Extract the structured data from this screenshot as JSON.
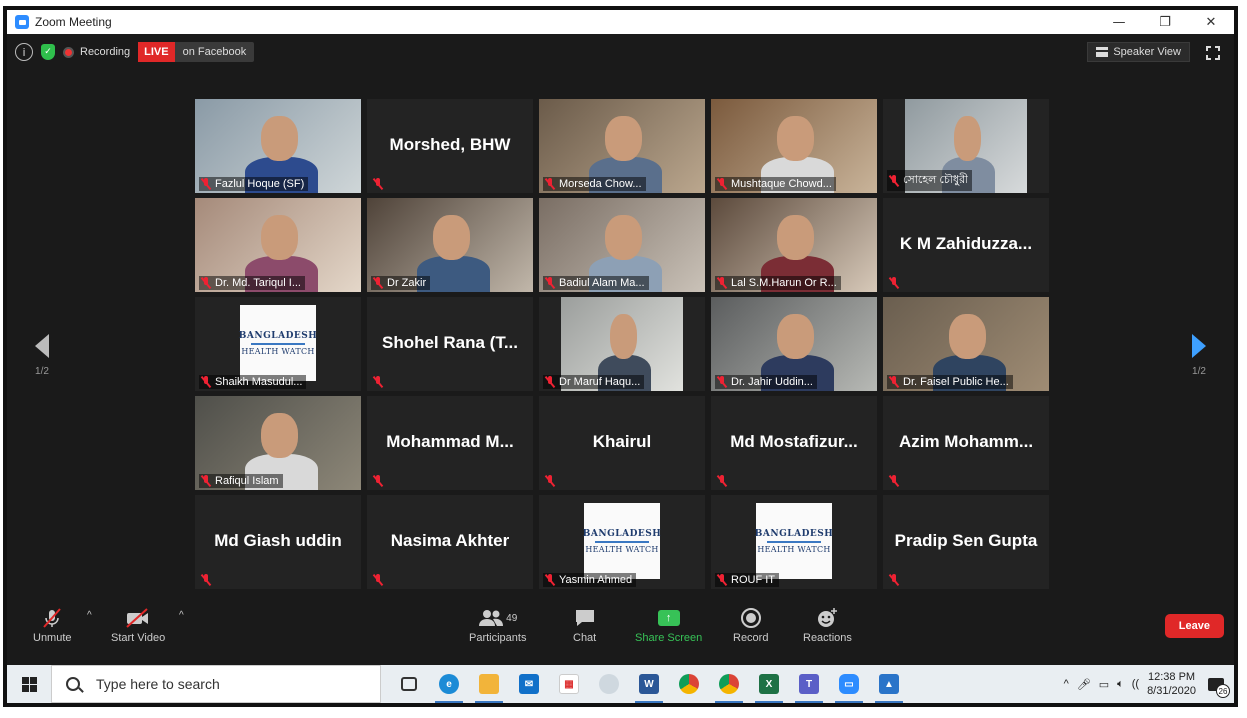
{
  "window": {
    "title": "Zoom Meeting",
    "controls": [
      "—",
      "❐",
      "✕"
    ]
  },
  "meeting_top": {
    "recording_label": "Recording",
    "live_badge": "LIVE",
    "live_target": "on Facebook",
    "view_button": "Speaker View"
  },
  "pager": {
    "left_page": "1/2",
    "right_page": "1/2"
  },
  "participants": [
    {
      "label": "Fazlul Hoque (SF)",
      "video": true
    },
    {
      "label": "Morshed, BHW",
      "video": false
    },
    {
      "label": "Morseda Chow...",
      "video": true
    },
    {
      "label": "Mushtaque Chowd...",
      "video": true
    },
    {
      "label": "সোহেল চৌধুরী",
      "video": true
    },
    {
      "label": "Dr. Md. Tariqul I...",
      "video": true
    },
    {
      "label": "Dr Zakir",
      "video": true
    },
    {
      "label": "Badiul Alam Ma...",
      "video": true
    },
    {
      "label": "Lal S.M.Harun Or R...",
      "video": true
    },
    {
      "label": "K M Zahiduzza...",
      "video": false
    },
    {
      "label": "Shaikh Masudul...",
      "video": "logo"
    },
    {
      "label": "Shohel Rana (T...",
      "video": false
    },
    {
      "label": "Dr Maruf Haqu...",
      "video": true
    },
    {
      "label": "Dr. Jahir Uddin...",
      "video": true
    },
    {
      "label": "Dr. Faisel Public He...",
      "video": true,
      "active": true
    },
    {
      "label": "Rafiqul Islam",
      "video": true
    },
    {
      "label": "Mohammad M...",
      "video": false
    },
    {
      "label": "Khairul",
      "video": false
    },
    {
      "label": "Md Mostafizur...",
      "video": false
    },
    {
      "label": "Azim Mohamm...",
      "video": false
    },
    {
      "label": "Md Giash uddin",
      "video": false
    },
    {
      "label": "Nasima Akhter",
      "video": false
    },
    {
      "label": "Yasmin Ahmed",
      "video": "logo"
    },
    {
      "label": "ROUF IT",
      "video": "logo"
    },
    {
      "label": "Pradip Sen Gupta",
      "video": false
    }
  ],
  "logo": {
    "line1": "BANGLADESH",
    "line2": "HEALTH WATCH"
  },
  "toolbar": {
    "unmute": "Unmute",
    "start_video": "Start Video",
    "participants": "Participants",
    "participants_count": "49",
    "chat": "Chat",
    "share_screen": "Share Screen",
    "record": "Record",
    "reactions": "Reactions",
    "leave": "Leave"
  },
  "taskbar": {
    "search_placeholder": "Type here to search",
    "time": "12:38 PM",
    "date": "8/31/2020",
    "notification_count": "26"
  },
  "colors": {
    "accent": "#2d8cff",
    "live": "#e02828",
    "active_speaker": "#c8e34a",
    "share": "#37c257"
  }
}
